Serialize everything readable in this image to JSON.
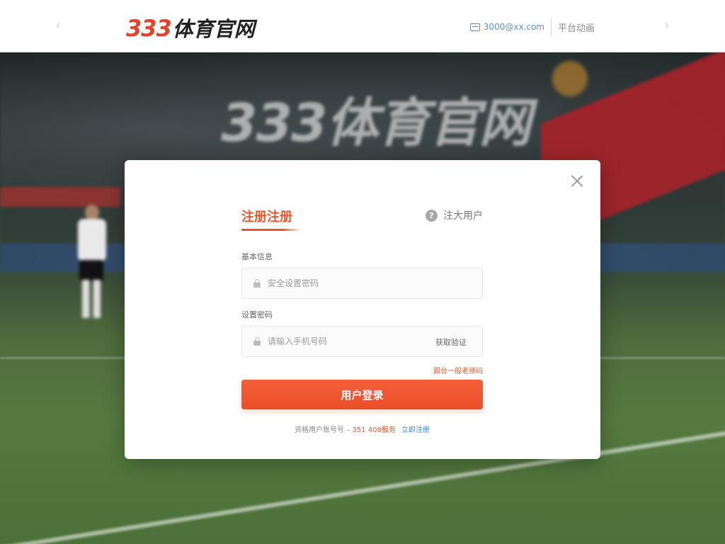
{
  "header": {
    "logo_number": "333",
    "logo_text": "体育官网",
    "hotline_label": "3000@xx.com",
    "platform_link": "平台动画",
    "nav_prev": "‹",
    "nav_next": "›"
  },
  "background": {
    "banner_text": "333体育官网"
  },
  "modal": {
    "close_icon": "close-icon",
    "tab_active": "注册注册",
    "tab_other": "注大用户",
    "help_icon_glyph": "?",
    "field1_label": "基本信息",
    "field1_placeholder": "安全设置密码",
    "field2_label": "设置密码",
    "field2_placeholder": "请输入手机号码",
    "field2_suffix": "获取验证",
    "forgot_link": "跟台一般老师码",
    "login_button": "用户登录",
    "footer_text": "资格用户账号号 – ",
    "footer_highlight": "351 408服务",
    "footer_link": "立即注册"
  },
  "colors": {
    "accent": "#e5572f",
    "button": "#ea4f2a",
    "link_blue": "#3a8fd6",
    "logo_red": "#e8412a"
  }
}
